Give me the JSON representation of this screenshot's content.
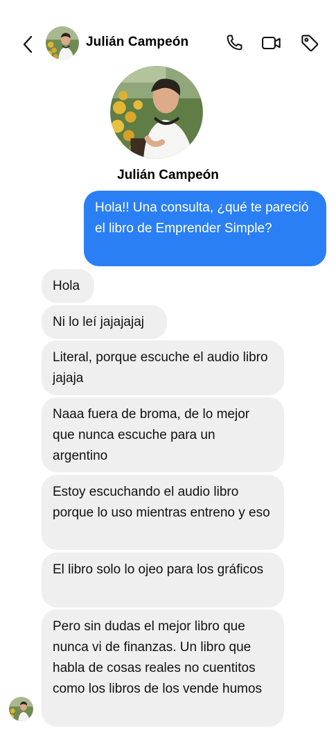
{
  "contact": {
    "name": "Julián Campeón"
  },
  "header_icons": {
    "back": "chevron-left-icon",
    "call": "phone-icon",
    "video": "video-camera-icon",
    "tag": "tag-icon"
  },
  "colors": {
    "sent_bubble": "#2b7ff5",
    "received_bubble": "#efefef"
  },
  "messages": [
    {
      "direction": "sent",
      "text": "Hola!! Una consulta, ¿qué te pareció el libro de Emprender Simple?"
    },
    {
      "direction": "received",
      "text": "Hola"
    },
    {
      "direction": "received",
      "text": "Ni lo leí jajajajaj"
    },
    {
      "direction": "received",
      "text": "Literal, porque escuche el audio libro jajaja"
    },
    {
      "direction": "received",
      "text": "Naaa fuera de broma, de lo mejor que nunca escuche para un argentino"
    },
    {
      "direction": "received",
      "text": "Estoy escuchando el audio libro porque lo uso mientras entreno y eso"
    },
    {
      "direction": "received",
      "text": "El libro solo lo ojeo para los gráficos"
    },
    {
      "direction": "received",
      "text": "Pero sin dudas el mejor libro que nunca vi de finanzas. Un libro que habla de cosas reales no cuentitos como los libros de los vende humos"
    }
  ]
}
